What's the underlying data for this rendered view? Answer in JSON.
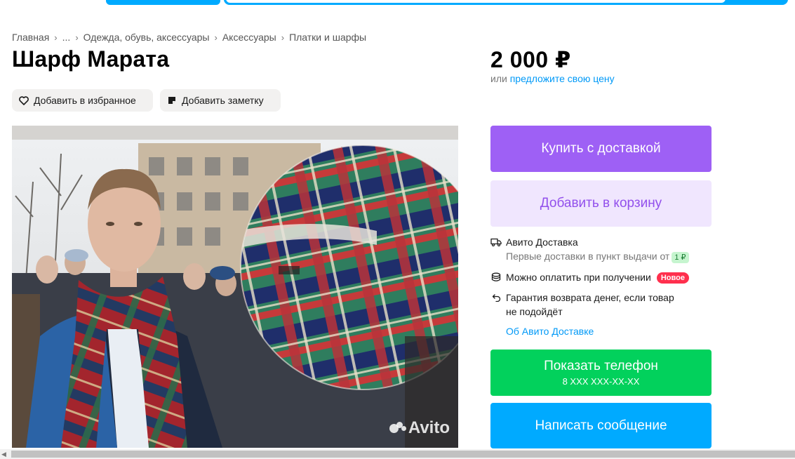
{
  "header": {
    "search_placeholder": ""
  },
  "breadcrumb": [
    {
      "label": "Главная"
    },
    {
      "label": "..."
    },
    {
      "label": "Одежда, обувь, аксессуары"
    },
    {
      "label": "Аксессуары"
    },
    {
      "label": "Платки и шарфы"
    }
  ],
  "listing": {
    "title": "Шарф Марата",
    "price": "2 000 ₽",
    "price_prefix": "или",
    "price_offer_link": "предложите свою цену",
    "favorite_label": "Добавить в избранное",
    "note_label": "Добавить заметку",
    "photo_watermark": "Avito"
  },
  "actions": {
    "buy_label": "Купить с доставкой",
    "cart_label": "Добавить в корзину",
    "phone_label": "Показать телефон",
    "phone_number": "8 XXX XXX-XX-XX",
    "message_label": "Написать сообщение"
  },
  "delivery": {
    "title": "Авито Доставка",
    "subtitle": "Первые доставки в пункт выдачи от",
    "subtitle_badge": "1 ₽",
    "payment": "Можно оплатить при получении",
    "payment_badge": "Новое",
    "guarantee_line1": "Гарантия возврата денег, если товар",
    "guarantee_line2": "не подойдёт",
    "about_link": "Об Авито Доставке"
  },
  "colors": {
    "buy": "#9e60f5",
    "cart_bg": "#f0e6fe",
    "phone": "#02d15c",
    "message": "#00aaff",
    "link": "#0099f7"
  },
  "icons": {
    "favorite": "heart-icon",
    "note": "note-icon",
    "delivery": "truck-icon",
    "payment": "coins-icon",
    "guarantee": "return-arrow-icon"
  }
}
